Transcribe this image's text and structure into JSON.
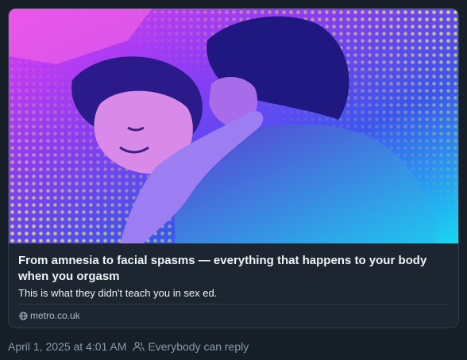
{
  "link_card": {
    "title": "From amnesia to facial spasms — everything that happens to your body when you orgasm",
    "description": "This is what they didn't teach you in sex ed.",
    "domain": "metro.co.uk",
    "domain_icon": "globe-icon"
  },
  "post_meta": {
    "timestamp": "April 1, 2025 at 4:01 AM",
    "reply_setting": "Everybody can reply",
    "reply_icon": "people-icon"
  },
  "colors": {
    "background": "#161e27",
    "card_border": "#2e3b49",
    "text_primary": "#f1f3f5",
    "text_secondary": "#8a9aab"
  }
}
